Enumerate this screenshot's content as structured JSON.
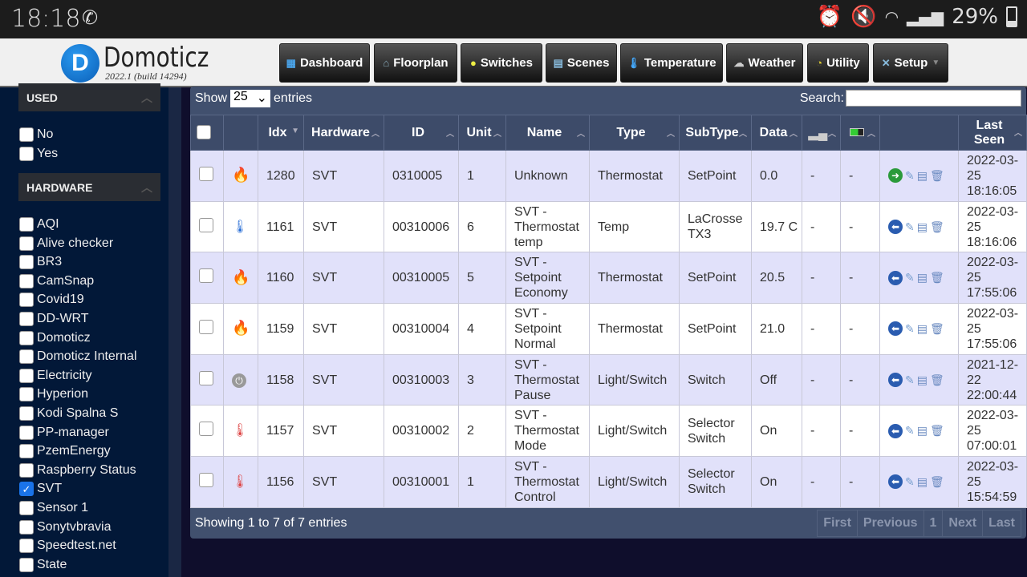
{
  "status_bar": {
    "time": "18:18",
    "battery": "29%",
    "battery_level": 0.29,
    "icons": [
      "viber-icon",
      "alarm-icon",
      "vibrate-mute-icon",
      "wifi-icon",
      "signal-icon",
      "battery-icon"
    ]
  },
  "header": {
    "brand": "Domoticz",
    "version": "2022.1 (build 14294)",
    "nav": [
      {
        "label": "Dashboard",
        "icon": "dashboard-icon"
      },
      {
        "label": "Floorplan",
        "icon": "floorplan-icon"
      },
      {
        "label": "Switches",
        "icon": "bulb-icon"
      },
      {
        "label": "Scenes",
        "icon": "scenes-icon"
      },
      {
        "label": "Temperature",
        "icon": "thermometer-icon"
      },
      {
        "label": "Weather",
        "icon": "weather-icon"
      },
      {
        "label": "Utility",
        "icon": "utility-icon"
      },
      {
        "label": "Setup",
        "icon": "tools-icon"
      }
    ]
  },
  "sidebar": {
    "used_title": "USED",
    "used": [
      {
        "label": "No",
        "checked": false
      },
      {
        "label": "Yes",
        "checked": false
      }
    ],
    "hardware_title": "HARDWARE",
    "hardware": [
      {
        "label": "AQI",
        "checked": false
      },
      {
        "label": "Alive checker",
        "checked": false
      },
      {
        "label": "BR3",
        "checked": false
      },
      {
        "label": "CamSnap",
        "checked": false
      },
      {
        "label": "Covid19",
        "checked": false
      },
      {
        "label": "DD-WRT",
        "checked": false
      },
      {
        "label": "Domoticz",
        "checked": false
      },
      {
        "label": "Domoticz Internal",
        "checked": false
      },
      {
        "label": "Electricity",
        "checked": false
      },
      {
        "label": "Hyperion",
        "checked": false
      },
      {
        "label": "Kodi Spalna S",
        "checked": false
      },
      {
        "label": "PP-manager",
        "checked": false
      },
      {
        "label": "PzemEnergy",
        "checked": false
      },
      {
        "label": "Raspberry Status",
        "checked": false
      },
      {
        "label": "SVT",
        "checked": true
      },
      {
        "label": "Sensor 1",
        "checked": false
      },
      {
        "label": "Sonytvbravia",
        "checked": false
      },
      {
        "label": "Speedtest.net",
        "checked": false
      },
      {
        "label": "State",
        "checked": false
      }
    ]
  },
  "table": {
    "show_label": "Show",
    "entries_value": "25",
    "entries_label": "entries",
    "search_label": "Search:",
    "search_value": "",
    "columns": [
      "",
      "",
      "Idx",
      "Hardware",
      "ID",
      "Unit",
      "Name",
      "Type",
      "SubType",
      "Data",
      "",
      "",
      "",
      "Last Seen"
    ],
    "rows": [
      {
        "icon": "flame-icon",
        "idx": "1280",
        "hardware": "SVT",
        "id": "0310005",
        "unit": "1",
        "name": "Unknown",
        "type": "Thermostat",
        "subtype": "SetPoint",
        "data": "0.0",
        "signal": "-",
        "battery": "-",
        "action": "green",
        "last_seen": "2022-03-25 18:16:05"
      },
      {
        "icon": "thermometer-icon",
        "idx": "1161",
        "hardware": "SVT",
        "id": "00310006",
        "unit": "6",
        "name": "SVT - Thermostat temp",
        "type": "Temp",
        "subtype": "LaCrosse TX3",
        "data": "19.7 C",
        "signal": "-",
        "battery": "-",
        "action": "blue",
        "last_seen": "2022-03-25 18:16:06"
      },
      {
        "icon": "flame-icon",
        "idx": "1160",
        "hardware": "SVT",
        "id": "00310005",
        "unit": "5",
        "name": "SVT - Setpoint Economy",
        "type": "Thermostat",
        "subtype": "SetPoint",
        "data": "20.5",
        "signal": "-",
        "battery": "-",
        "action": "blue",
        "last_seen": "2022-03-25 17:55:06"
      },
      {
        "icon": "flame-icon",
        "idx": "1159",
        "hardware": "SVT",
        "id": "00310004",
        "unit": "4",
        "name": "SVT - Setpoint Normal",
        "type": "Thermostat",
        "subtype": "SetPoint",
        "data": "21.0",
        "signal": "-",
        "battery": "-",
        "action": "blue",
        "last_seen": "2022-03-25 17:55:06"
      },
      {
        "icon": "power-icon",
        "idx": "1158",
        "hardware": "SVT",
        "id": "00310003",
        "unit": "3",
        "name": "SVT - Thermostat Pause",
        "type": "Light/Switch",
        "subtype": "Switch",
        "data": "Off",
        "signal": "-",
        "battery": "-",
        "action": "blue",
        "last_seen": "2021-12-22 22:00:44"
      },
      {
        "icon": "thermostat-icon",
        "idx": "1157",
        "hardware": "SVT",
        "id": "00310002",
        "unit": "2",
        "name": "SVT - Thermostat Mode",
        "type": "Light/Switch",
        "subtype": "Selector Switch",
        "data": "On",
        "signal": "-",
        "battery": "-",
        "action": "blue",
        "last_seen": "2022-03-25 07:00:01"
      },
      {
        "icon": "thermostat-icon",
        "idx": "1156",
        "hardware": "SVT",
        "id": "00310001",
        "unit": "1",
        "name": "SVT - Thermostat Control",
        "type": "Light/Switch",
        "subtype": "Selector Switch",
        "data": "On",
        "signal": "-",
        "battery": "-",
        "action": "blue",
        "last_seen": "2022-03-25 15:54:59"
      }
    ],
    "footer": "Showing 1 to 7 of 7 entries",
    "pager": [
      "First",
      "Previous",
      "1",
      "Next",
      "Last"
    ]
  },
  "colors": {
    "row_alt": "#e1e1fa",
    "header_bg": "#3d4b69",
    "sidebar_bg": "#021838",
    "page_bg": "#0f0e2c"
  }
}
